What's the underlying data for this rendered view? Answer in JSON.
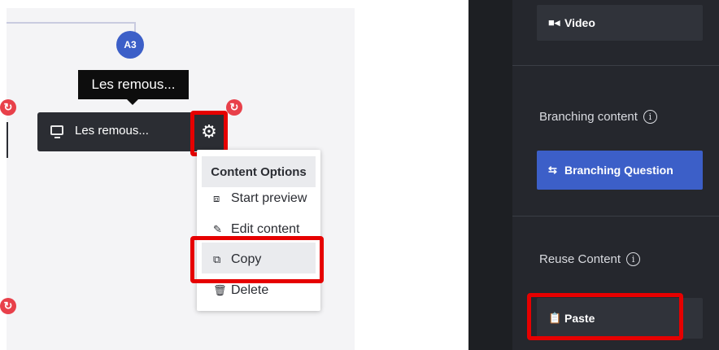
{
  "flow": {
    "badge": "A3",
    "tooltip": "Les remous...",
    "node_label": "Les remous..."
  },
  "menu": {
    "title": "Content Options",
    "items": [
      {
        "label": "Start preview",
        "icon": "play-square-icon"
      },
      {
        "label": "Edit content",
        "icon": "pencil-icon"
      },
      {
        "label": "Copy",
        "icon": "copy-icon"
      },
      {
        "label": "Delete",
        "icon": "trash-icon"
      }
    ]
  },
  "sidebar": {
    "video_label": "Video",
    "branching_heading": "Branching content",
    "branching_button": "Branching Question",
    "reuse_heading": "Reuse Content",
    "paste_label": "Paste"
  },
  "colors": {
    "accent": "#3c5fc8",
    "highlight": "#e60000",
    "node_bg": "#2b2d33",
    "sidebar_bg": "#25272d",
    "sync_icon": "#e8404a"
  }
}
